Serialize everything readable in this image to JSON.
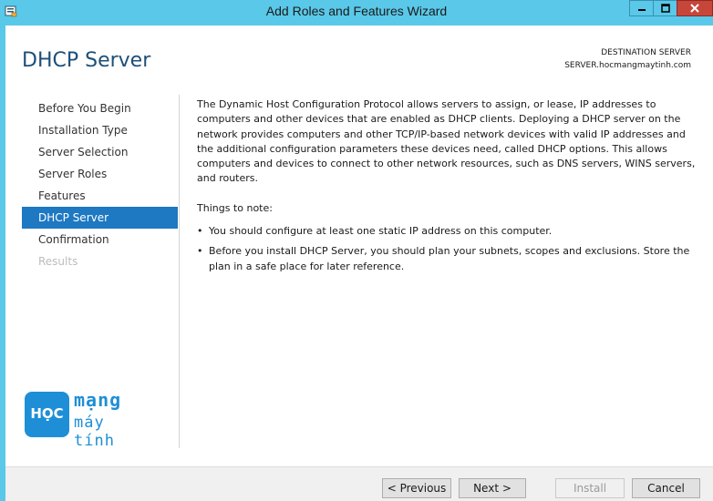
{
  "window": {
    "title": "Add Roles and Features Wizard"
  },
  "header": {
    "page_title": "DHCP Server",
    "destination_label": "DESTINATION SERVER",
    "destination_server": "SERVER.hocmangmaytinh.com"
  },
  "nav": {
    "items": [
      {
        "label": "Before You Begin",
        "state": "normal"
      },
      {
        "label": "Installation Type",
        "state": "normal"
      },
      {
        "label": "Server Selection",
        "state": "normal"
      },
      {
        "label": "Server Roles",
        "state": "normal"
      },
      {
        "label": "Features",
        "state": "normal"
      },
      {
        "label": "DHCP Server",
        "state": "active"
      },
      {
        "label": "Confirmation",
        "state": "normal"
      },
      {
        "label": "Results",
        "state": "disabled"
      }
    ]
  },
  "main": {
    "description": "The Dynamic Host Configuration Protocol allows servers to assign, or lease, IP addresses to computers and other devices that are enabled as DHCP clients. Deploying a DHCP server on the network provides computers and other TCP/IP-based network devices with valid IP addresses and the additional configuration parameters these devices need, called DHCP options. This allows computers and devices to connect to other network resources, such as DNS servers, WINS servers, and routers.",
    "notes_title": "Things to note:",
    "notes": [
      "You should configure at least one static IP address on this computer.",
      "Before you install DHCP Server, you should plan your subnets, scopes and exclusions. Store the plan in a safe place for later reference."
    ]
  },
  "logo": {
    "text_box": "HỌC",
    "text_top": "mạng",
    "text_bottom": "máy tính"
  },
  "footer": {
    "previous_label": "< Previous",
    "next_label": "Next >",
    "install_label": "Install",
    "cancel_label": "Cancel"
  },
  "colors": {
    "titlebar": "#5ac8e8",
    "accent": "#1e78c2",
    "page_title": "#1e4f78",
    "close_button": "#c7463a"
  }
}
